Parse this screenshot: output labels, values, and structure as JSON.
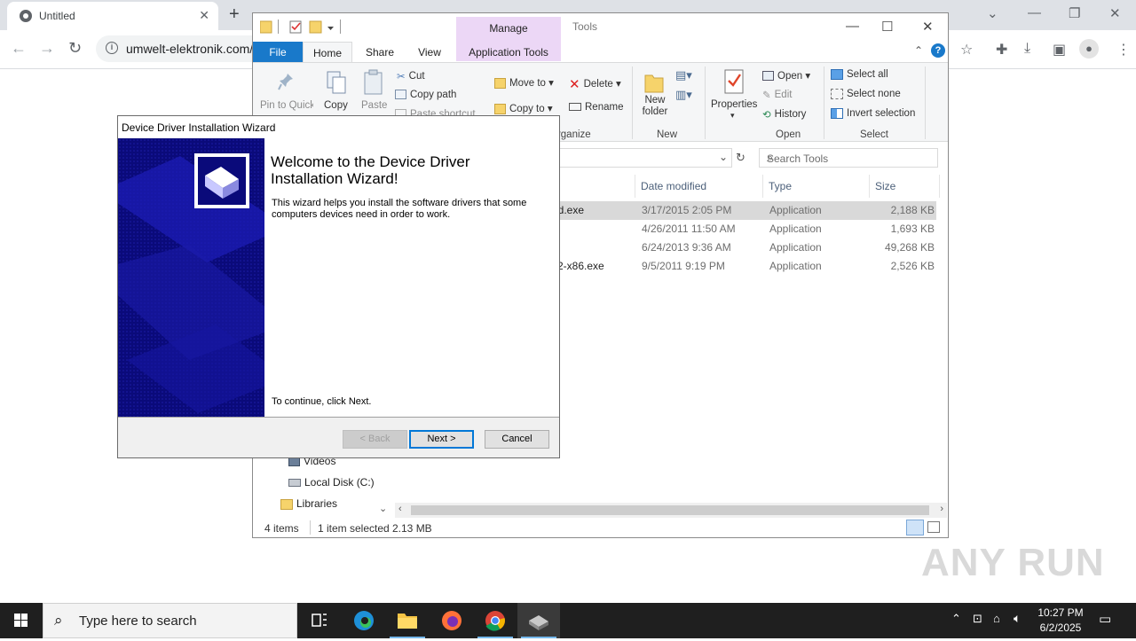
{
  "browser": {
    "tab_title": "Untitled",
    "url": "umwelt-elektronik.com/"
  },
  "explorer": {
    "title": "Tools",
    "manage_label": "Manage",
    "ribbon_tabs": {
      "file": "File",
      "home": "Home",
      "share": "Share",
      "view": "View",
      "app_tools": "Application Tools"
    },
    "clipboard": {
      "pin": "Pin to Quick access",
      "copy": "Copy",
      "paste": "Paste",
      "cut": "Cut",
      "copy_path": "Copy path",
      "paste_shortcut": "Paste shortcut"
    },
    "organize": {
      "move_to": "Move to",
      "copy_to": "Copy to",
      "delete": "Delete",
      "rename": "Rename",
      "group": "Organize"
    },
    "new": {
      "new_folder": "New folder",
      "group": "New"
    },
    "open": {
      "properties": "Properties",
      "open": "Open",
      "edit": "Edit",
      "history": "History",
      "group": "Open"
    },
    "select": {
      "select_all": "Select all",
      "select_none": "Select none",
      "invert": "Invert selection",
      "group": "Select"
    },
    "search_placeholder": "Search Tools",
    "columns": {
      "date": "Date modified",
      "type": "Type",
      "size": "Size"
    },
    "files": [
      {
        "name": "ed.exe",
        "date": "3/17/2015 2:05 PM",
        "type": "Application",
        "size": "2,188 KB"
      },
      {
        "name": "",
        "date": "4/26/2011 11:50 AM",
        "type": "Application",
        "size": "1,693 KB"
      },
      {
        "name": "e",
        "date": "6/24/2013 9:36 AM",
        "type": "Application",
        "size": "49,268 KB"
      },
      {
        "name": "v2-x86.exe",
        "date": "9/5/2011 9:19 PM",
        "type": "Application",
        "size": "2,526 KB"
      }
    ],
    "nav": {
      "videos": "Videos",
      "local_disk": "Local Disk (C:)",
      "libraries": "Libraries"
    },
    "status": {
      "count": "4 items",
      "selected": "1 item selected",
      "size": "2.13 MB"
    }
  },
  "wizard": {
    "title": "Device Driver Installation Wizard",
    "heading": "Welcome to the Device Driver Installation Wizard!",
    "description": "This wizard helps you install the software drivers that some computers devices need in order to work.",
    "continue_text": "To continue, click Next.",
    "back": "< Back",
    "next": "Next >",
    "cancel": "Cancel"
  },
  "taskbar": {
    "search_placeholder": "Type here to search",
    "time": "10:27 PM",
    "date": "6/2/2025"
  },
  "watermark": "ANY RUN",
  "colors": {
    "file_tab": "#1979ca",
    "manage_tab": "#ecd7f6",
    "wizard_banner": "#0a0a7a",
    "selection": "#d9d9d9"
  }
}
